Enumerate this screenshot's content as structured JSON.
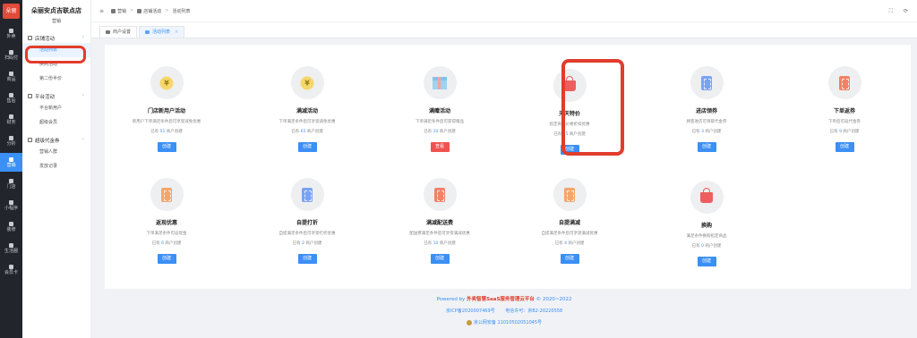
{
  "brand": {
    "logo_text": "朵丽"
  },
  "rail": [
    {
      "label": "外卖",
      "active": false
    },
    {
      "label": "扫码付",
      "active": false
    },
    {
      "label": "商品",
      "active": false
    },
    {
      "label": "售后",
      "active": false
    },
    {
      "label": "财务",
      "active": false
    },
    {
      "label": "分析",
      "active": false
    },
    {
      "label": "营销",
      "active": true
    },
    {
      "label": "门店",
      "active": false
    },
    {
      "label": "小程序",
      "active": false
    },
    {
      "label": "装修",
      "active": false
    },
    {
      "label": "生活圈",
      "active": false
    },
    {
      "label": "会员卡",
      "active": false
    }
  ],
  "sidebar": {
    "store_name": "朵丽安贞吉联点店",
    "store_sub": "营销",
    "groups": [
      {
        "label": "店铺活动",
        "items": [
          "活动列表",
          "换购活动",
          "第二份半价"
        ]
      },
      {
        "label": "平台活动",
        "items": [
          "平台新用户",
          "超级会员"
        ]
      },
      {
        "label": "超级代金券",
        "items": [
          "营销人群",
          "发放记录"
        ]
      }
    ],
    "active_item": "活动列表"
  },
  "topbar": {
    "breadcrumb": [
      "营销",
      "店铺活动",
      "活动列表"
    ],
    "fold_icon": "≡"
  },
  "tabs": [
    {
      "label": "商户设置",
      "active": false
    },
    {
      "label": "活动列表",
      "active": true,
      "close": "×"
    }
  ],
  "activities": [
    {
      "title": "门店新用户活动",
      "desc": "新用户下单满足条件后可享受减免优惠",
      "count_pre": "已有 ",
      "count": "51",
      "count_post": " 商户创建",
      "button": "创建",
      "icon": "coin",
      "button_style": "blue"
    },
    {
      "title": "满减活动",
      "desc": "下单满足条件后可享受减免优惠",
      "count_pre": "已有 ",
      "count": "65",
      "count_post": " 商户创建",
      "button": "创建",
      "icon": "coin",
      "button_style": "blue"
    },
    {
      "title": "满赠活动",
      "desc": "下单满足条件后可获得赠品",
      "count_pre": "已有 ",
      "count": "10",
      "count_post": " 商户创建",
      "button": "查看",
      "icon": "gift",
      "button_style": "red"
    },
    {
      "title": "天天特价",
      "desc": "指定商品价格折扣优惠",
      "count_pre": "已有 ",
      "count": "25",
      "count_post": " 商户创建",
      "button": "创建",
      "icon": "bag",
      "button_style": "blue"
    },
    {
      "title": "进店领券",
      "desc": "顾客进店可领取代金券",
      "count_pre": "已有 ",
      "count": "3",
      "count_post": " 商户创建",
      "button": "创建",
      "icon": "ticket-blue",
      "button_style": "blue"
    },
    {
      "title": "下单返券",
      "desc": "下单后可返代金券",
      "count_pre": "已有 ",
      "count": "9",
      "count_post": " 商户创建",
      "button": "创建",
      "icon": "ticket-red",
      "button_style": "blue"
    },
    {
      "title": "返现优惠",
      "desc": "下单满足条件可返现金",
      "count_pre": "已有 ",
      "count": "6",
      "count_post": " 商户创建",
      "button": "创建",
      "icon": "ticket-orange",
      "button_style": "blue"
    },
    {
      "title": "自提打折",
      "desc": "自提满足条件后可享受打折优惠",
      "count_pre": "已有 ",
      "count": "2",
      "count_post": " 商户创建",
      "button": "创建",
      "icon": "ticket-blue",
      "button_style": "blue"
    },
    {
      "title": "满减配送费",
      "desc": "配送费满足条件后可享受满减优惠",
      "count_pre": "已有 ",
      "count": "10",
      "count_post": " 商户创建",
      "button": "创建",
      "icon": "ticket-red",
      "button_style": "blue"
    },
    {
      "title": "自提满减",
      "desc": "自提满足条件后可享受满减优惠",
      "count_pre": "已有 ",
      "count": "4",
      "count_post": " 商户创建",
      "button": "创建",
      "icon": "ticket-orange",
      "button_style": "blue"
    },
    {
      "title": "换购",
      "desc": "满足条件换购指定商品",
      "count_pre": "已有 ",
      "count": "0",
      "count_post": " 商户创建",
      "button": "创建",
      "icon": "bag",
      "button_style": "blue"
    }
  ],
  "footer": {
    "powered_pre": "Powered by ",
    "powered_brand": "外卖智慧SaaS服务管理云平台",
    "powered_post": " © 2020~2022",
    "icp": "京ICP备2020007469号",
    "license": "电信许可：京B2-20220558",
    "police": "京公网安备 11010502051045号"
  },
  "colors": {
    "accent": "#3b8ff5",
    "highlight": "#e13c2c",
    "rail_bg": "#22252b"
  }
}
